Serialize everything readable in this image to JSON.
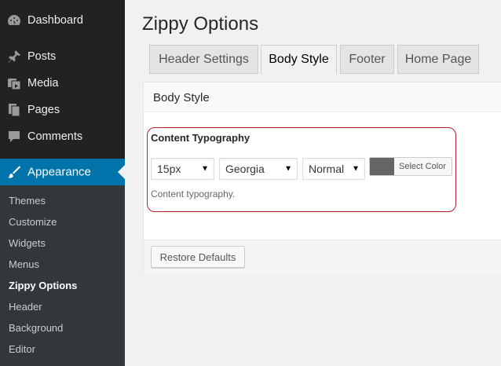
{
  "sidebar": {
    "menu": [
      {
        "label": "Dashboard",
        "icon": "dashboard-icon"
      },
      {
        "label": "Posts",
        "icon": "pin-icon"
      },
      {
        "label": "Media",
        "icon": "media-icon"
      },
      {
        "label": "Pages",
        "icon": "pages-icon"
      },
      {
        "label": "Comments",
        "icon": "comment-icon"
      },
      {
        "label": "Appearance",
        "icon": "brush-icon"
      }
    ],
    "submenu": [
      "Themes",
      "Customize",
      "Widgets",
      "Menus",
      "Zippy Options",
      "Header",
      "Background",
      "Editor"
    ],
    "accent_color": "#0073aa"
  },
  "page": {
    "title": "Zippy Options",
    "tabs": [
      "Header Settings",
      "Body Style",
      "Footer",
      "Home Page"
    ],
    "active_tab": "Body Style"
  },
  "panel": {
    "title": "Body Style",
    "section_label": "Content Typography",
    "font_size": "15px",
    "font_family": "Georgia",
    "font_weight": "Normal",
    "color_button_label": "Select Color",
    "color_value": "#666666",
    "description": "Content typography.",
    "restore_label": "Restore Defaults",
    "highlight_color": "#b0202a"
  }
}
